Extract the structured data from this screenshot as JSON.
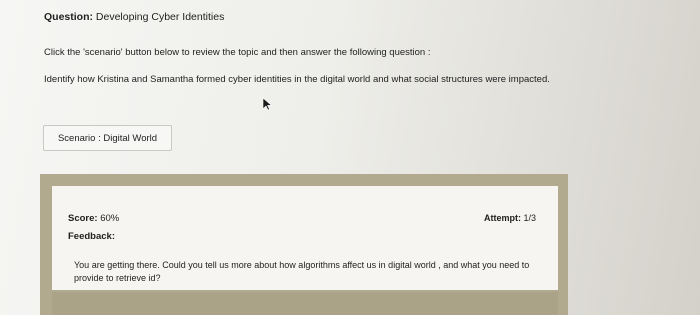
{
  "question": {
    "label": "Question:",
    "title": "Developing Cyber Identities"
  },
  "instruction": "Click the 'scenario' button below to review the topic and then answer the following question :",
  "prompt": "Identify how Kristina and Samantha formed cyber identities in the digital world and what social structures were impacted.",
  "scenario_button": {
    "label": "Scenario : Digital World"
  },
  "result": {
    "score_label": "Score:",
    "score_value": "60%",
    "attempt_label": "Attempt:",
    "attempt_value": "1/3",
    "feedback_label": "Feedback:",
    "feedback_text": "You are getting there. Could you tell us more about how algorithms affect us in digital world , and what you need to provide to retrieve id?"
  },
  "colors": {
    "panel_border": "#b1aa8e",
    "panel_inner": "#f6f5f1"
  }
}
